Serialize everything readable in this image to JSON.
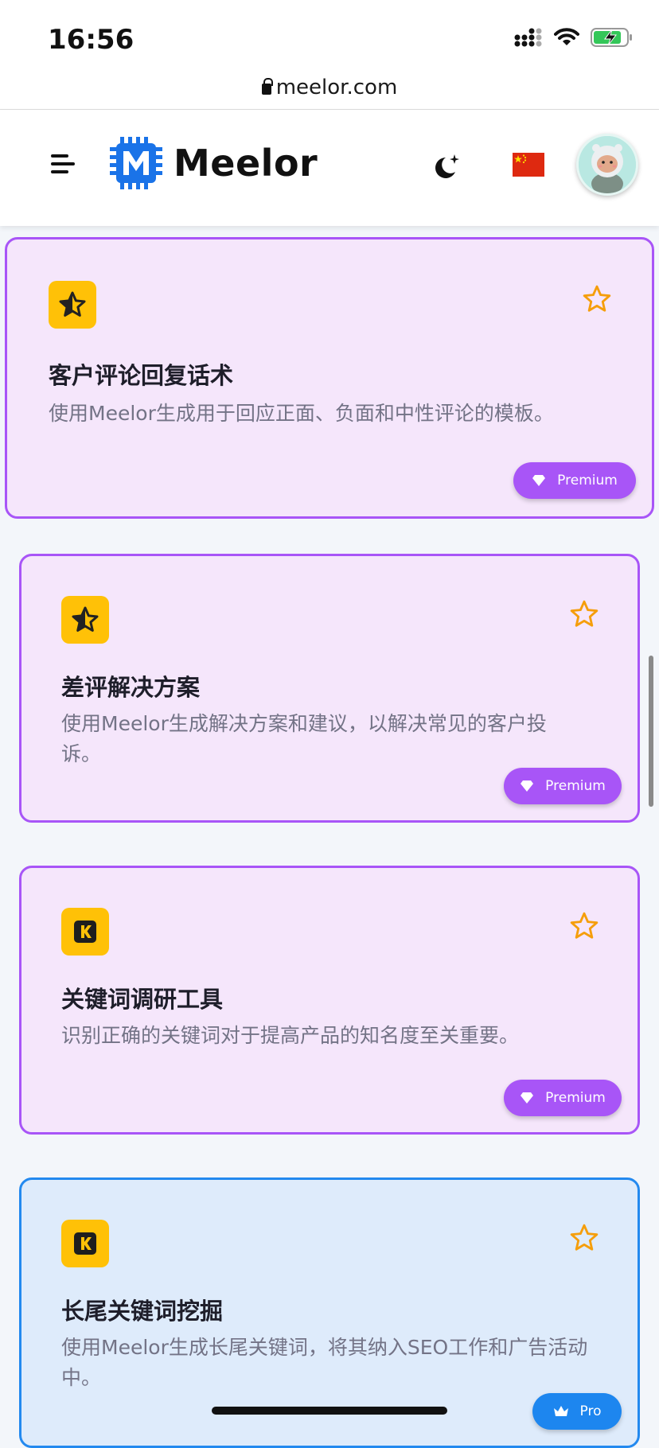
{
  "status_bar": {
    "time": "16:56"
  },
  "browser": {
    "url": "meelor.com"
  },
  "header": {
    "logo_text": "Meelor"
  },
  "cards": [
    {
      "title": "客户评论回复话术",
      "description": "使用Meelor生成用于回应正面、负面和中性评论的模板。",
      "badge": "Premium",
      "icon": "star-half-icon",
      "tier_color": "#a855f7"
    },
    {
      "title": "差评解决方案",
      "description": "使用Meelor生成解决方案和建议，以解决常见的客户投诉。",
      "badge": "Premium",
      "icon": "star-half-icon",
      "tier_color": "#a855f7"
    },
    {
      "title": "关键词调研工具",
      "description": "识别正确的关键词对于提高产品的知名度至关重要。",
      "badge": "Premium",
      "icon": "k-letter-icon",
      "tier_color": "#a855f7"
    },
    {
      "title": "长尾关键词挖掘",
      "description": "使用Meelor生成长尾关键词，将其纳入SEO工作和广告活动中。",
      "badge": "Pro",
      "icon": "k-letter-icon",
      "tier_color": "#2389ef"
    }
  ]
}
